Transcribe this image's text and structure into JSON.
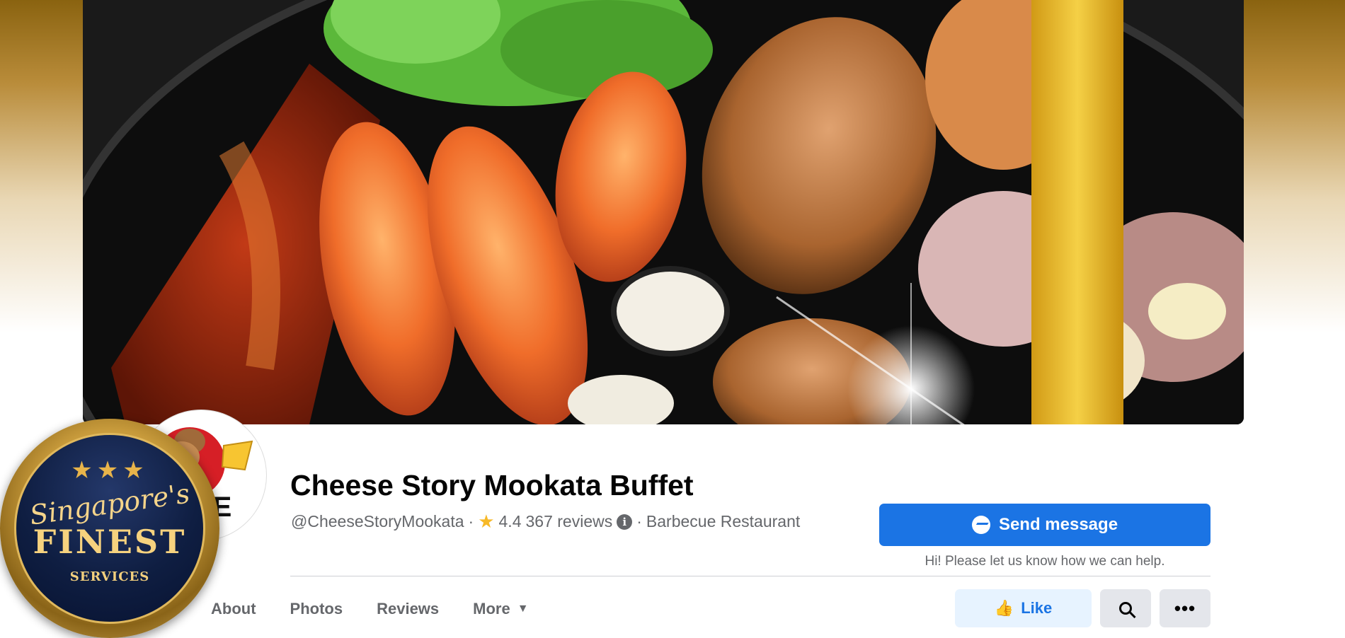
{
  "page": {
    "title": "Cheese Story Mookata Buffet",
    "handle": "@CheeseStoryMookata",
    "separator": "·",
    "rating": "4.4",
    "reviews": "367 reviews",
    "category": "Barbecue Restaurant",
    "info_glyph": "i"
  },
  "cta": {
    "send_label": "Send message",
    "helper": "Hi! Please let us know how we can help."
  },
  "tabs": [
    {
      "label": "About"
    },
    {
      "label": "Photos"
    },
    {
      "label": "Reviews"
    },
    {
      "label": "More"
    }
  ],
  "actions": {
    "like_label": "Like"
  },
  "badge": {
    "script": "Singapore's",
    "main": "FINEST",
    "sub": "SERVICES"
  },
  "colors": {
    "primary": "#1b74e4",
    "like_bg": "#e7f3ff",
    "gold": "#d9b25c"
  }
}
